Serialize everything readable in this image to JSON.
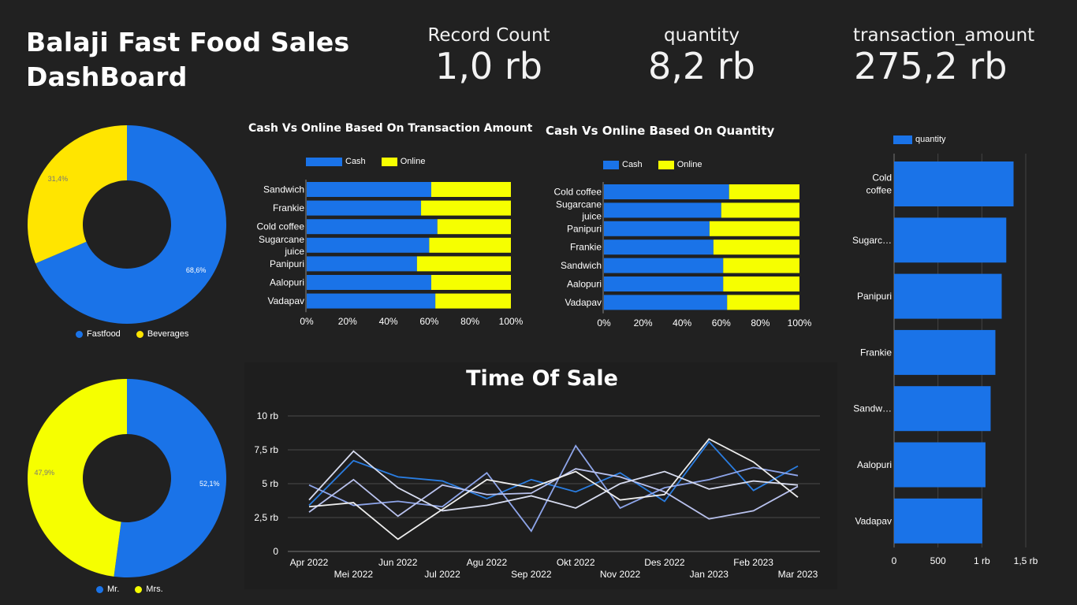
{
  "header": {
    "title_line1": "Balaji Fast Food Sales",
    "title_line2": "DashBoard"
  },
  "kpis": [
    {
      "label": "Record Count",
      "value": "1,0 rb"
    },
    {
      "label": "quantity",
      "value": "8,2 rb"
    },
    {
      "label": "transaction_amount",
      "value": "275,2 rb"
    }
  ],
  "colors": {
    "blue": "#1a73e8",
    "yellow": "#f6ff00",
    "pie_yellow": "#ffe500",
    "background": "#212121",
    "grid": "#555555"
  },
  "chart_data": [
    {
      "id": "pie-item-type",
      "type": "pie",
      "donut": true,
      "slices": [
        {
          "name": "Fastfood",
          "value": 68.6,
          "label": "68,6%",
          "color": "#1a73e8"
        },
        {
          "name": "Beverages",
          "value": 31.4,
          "label": "31,4%",
          "color": "#ffe500"
        }
      ],
      "legend": "bottom"
    },
    {
      "id": "pie-gender",
      "type": "pie",
      "donut": true,
      "slices": [
        {
          "name": "Mr.",
          "value": 52.1,
          "label": "52,1%",
          "color": "#1a73e8"
        },
        {
          "name": "Mrs.",
          "value": 47.9,
          "label": "47,9%",
          "color": "#f6ff00"
        }
      ],
      "legend": "bottom"
    },
    {
      "id": "bar-amount",
      "type": "bar",
      "orientation": "horizontal",
      "stacked_percent": true,
      "title": "Cash Vs Online Based On Transaction Amount",
      "categories": [
        "Sandwich",
        "Frankie",
        "Cold coffee",
        "Sugarcane juice",
        "Panipuri",
        "Aalopuri",
        "Vadapav"
      ],
      "category_lines": [
        [
          "Sandwich"
        ],
        [
          "Frankie"
        ],
        [
          "Cold coffee"
        ],
        [
          "Sugarcane",
          "juice"
        ],
        [
          "Panipuri"
        ],
        [
          "Aalopuri"
        ],
        [
          "Vadapav"
        ]
      ],
      "series": [
        {
          "name": "Cash",
          "values": [
            61,
            56,
            64,
            60,
            54,
            61,
            63
          ]
        },
        {
          "name": "Online",
          "values": [
            39,
            44,
            36,
            40,
            46,
            39,
            37
          ]
        }
      ],
      "xticks": [
        "0%",
        "20%",
        "40%",
        "60%",
        "80%",
        "100%"
      ],
      "xlim": [
        0,
        100
      ],
      "legend": "top"
    },
    {
      "id": "bar-quantity",
      "type": "bar",
      "orientation": "horizontal",
      "stacked_percent": true,
      "title": "Cash Vs Online Based On Quantity",
      "categories": [
        "Cold coffee",
        "Sugarcane juice",
        "Panipuri",
        "Frankie",
        "Sandwich",
        "Aalopuri",
        "Vadapav"
      ],
      "category_lines": [
        [
          "Cold coffee"
        ],
        [
          "Sugarcane",
          "juice"
        ],
        [
          "Panipuri"
        ],
        [
          "Frankie"
        ],
        [
          "Sandwich"
        ],
        [
          "Aalopuri"
        ],
        [
          "Vadapav"
        ]
      ],
      "series": [
        {
          "name": "Cash",
          "values": [
            64,
            60,
            54,
            56,
            61,
            61,
            63
          ]
        },
        {
          "name": "Online",
          "values": [
            36,
            40,
            46,
            44,
            39,
            39,
            37
          ]
        }
      ],
      "xticks": [
        "0%",
        "20%",
        "40%",
        "60%",
        "80%",
        "100%"
      ],
      "xlim": [
        0,
        100
      ],
      "legend": "top"
    },
    {
      "id": "bar-item-quantity",
      "type": "bar",
      "orientation": "horizontal",
      "categories": [
        "Cold coffee",
        "Sugarc…",
        "Panipuri",
        "Frankie",
        "Sandw…",
        "Aalopuri",
        "Vadapav"
      ],
      "category_lines": [
        [
          "Cold",
          "coffee"
        ],
        [
          "Sugarc…"
        ],
        [
          "Panipuri"
        ],
        [
          "Frankie"
        ],
        [
          "Sandw…"
        ],
        [
          "Aalopuri"
        ],
        [
          "Vadapav"
        ]
      ],
      "series": [
        {
          "name": "quantity",
          "values": [
            1361,
            1278,
            1226,
            1154,
            1100,
            1041,
            1005
          ]
        }
      ],
      "xticks": [
        "0",
        "500",
        "1 rb",
        "1,5 rb"
      ],
      "xlim": [
        0,
        1500
      ],
      "legend": "top-left"
    },
    {
      "id": "line-time-of-sale",
      "type": "line",
      "title": "Time Of Sale",
      "x": [
        "Apr 2022",
        "Mei 2022",
        "Jun 2022",
        "Jul 2022",
        "Agu 2022",
        "Sep 2022",
        "Okt 2022",
        "Nov 2022",
        "Des 2022",
        "Jan 2023",
        "Feb 2023",
        "Mar 2023"
      ],
      "yticks": [
        "0",
        "2,5 rb",
        "5 rb",
        "7,5 rb",
        "10 rb"
      ],
      "ylim": [
        0,
        10000
      ],
      "series": [
        {
          "values": [
            3400,
            6700,
            5500,
            5200,
            3900,
            5300,
            4400,
            5800,
            3700,
            8100,
            4500,
            6300
          ],
          "color": "#2a7de1"
        },
        {
          "values": [
            4900,
            3400,
            3700,
            3300,
            5800,
            1500,
            7800,
            3200,
            4700,
            5300,
            6200,
            5600
          ],
          "color": "#8ea5ea"
        },
        {
          "values": [
            2900,
            5300,
            2600,
            4900,
            4200,
            4300,
            6100,
            5500,
            4400,
            2400,
            3000,
            4800
          ],
          "color": "#b9c2ee"
        },
        {
          "values": [
            3800,
            7400,
            4700,
            3000,
            3400,
            4100,
            3200,
            5000,
            5900,
            4600,
            5200,
            4900
          ],
          "color": "#d7dcf0"
        },
        {
          "values": [
            3300,
            3600,
            900,
            3100,
            5300,
            4700,
            5900,
            3800,
            4200,
            8300,
            6600,
            4000
          ],
          "color": "#eeeeee"
        }
      ]
    }
  ]
}
